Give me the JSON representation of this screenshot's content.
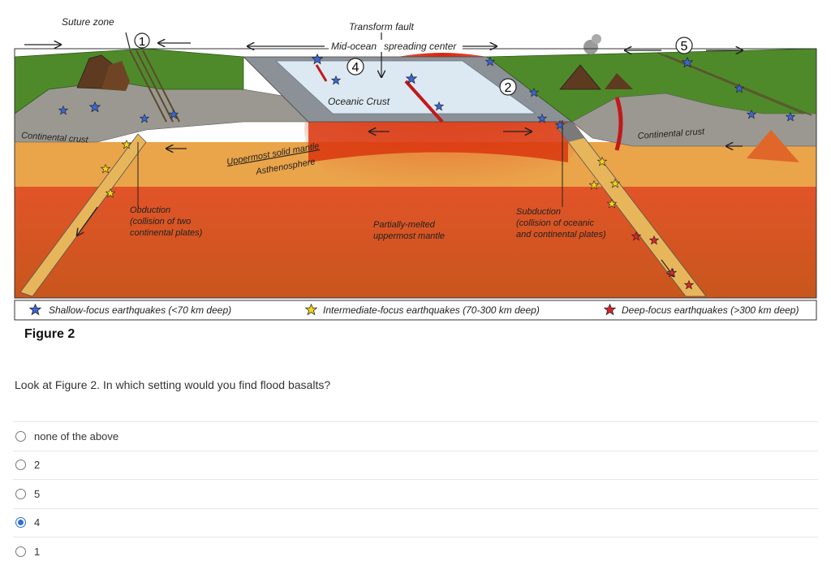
{
  "figure": {
    "labels": {
      "suture_zone": "Suture zone",
      "transform_fault": "Transform fault",
      "mid_ocean": "Mid-ocean",
      "spreading_center": "spreading center",
      "oceanic_crust": "Oceanic Crust",
      "continental_crust_left": "Continental crust",
      "continental_crust_right": "Continental crust",
      "uppermost_solid_mantle": "Uppermost solid mantle",
      "asthenosphere": "Asthenosphere",
      "obduction": "Obduction",
      "obduction_sub1": "(collision of two",
      "obduction_sub2": "continental plates)",
      "partially_melted1": "Partially-melted",
      "partially_melted2": "uppermost mantle",
      "subduction": "Subduction",
      "subduction_sub1": "(collision of oceanic",
      "subduction_sub2": "and continental plates)"
    },
    "markers": [
      "1",
      "2",
      "4",
      "5"
    ],
    "legend": {
      "shallow": "Shallow-focus earthquakes (<70 km deep)",
      "intermediate": "Intermediate-focus earthquakes (70-300 km deep)",
      "deep": "Deep-focus earthquakes (>300 km deep)"
    },
    "colors": {
      "shallow_star": "#3a66d8",
      "intermediate_star": "#f2d21c",
      "deep_star": "#d8242a",
      "crust_green": "#4f8a2a",
      "mantle_orange": "#e0662a",
      "ocean_light": "#dce9f2"
    }
  },
  "caption": "Figure 2",
  "question": "Look at Figure 2. In which setting would you find flood basalts?",
  "options": [
    {
      "label": "none of the above",
      "selected": false
    },
    {
      "label": "2",
      "selected": false
    },
    {
      "label": "5",
      "selected": false
    },
    {
      "label": "4",
      "selected": true
    },
    {
      "label": "1",
      "selected": false
    }
  ]
}
